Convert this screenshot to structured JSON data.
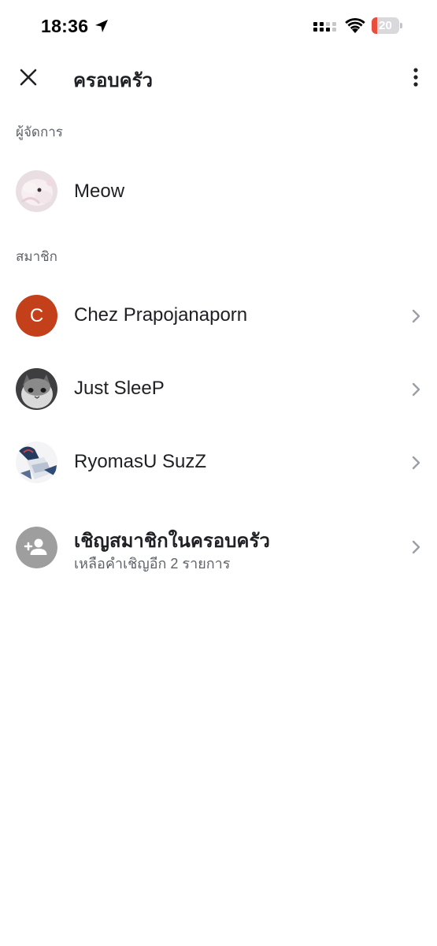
{
  "status_bar": {
    "time": "18:36",
    "battery_level": 20,
    "battery_text": "20",
    "icons": [
      "location-arrow-icon",
      "cellular-signal-icon",
      "wifi-icon",
      "battery-icon"
    ],
    "battery_color": "#eb4d3d"
  },
  "header": {
    "title": "ครอบครัว",
    "close_icon": "close-icon",
    "menu_icon": "more-vertical-icon"
  },
  "managers": {
    "label": "ผู้จัดการ",
    "items": [
      {
        "name": "Meow",
        "avatar": "photo-plush-toy"
      }
    ]
  },
  "members": {
    "label": "สมาชิก",
    "items": [
      {
        "name": "Chez Prapojanaporn",
        "avatar_letter": "C",
        "avatar_color": "#c3401b"
      },
      {
        "name": "Just SleeP",
        "avatar": "photo-cat"
      },
      {
        "name": "RyomasU SuzZ",
        "avatar": "photo-anime-figure"
      }
    ]
  },
  "invite": {
    "title": "เชิญสมาชิกในครอบครัว",
    "subtitle": "เหลือคำเชิญอีก 2 รายการ",
    "icon": "add-person-icon"
  },
  "colors": {
    "text_primary": "#202124",
    "text_secondary": "#5f6368",
    "chevron": "#9aa0a6",
    "invite_avatar_bg": "#9e9e9e"
  }
}
